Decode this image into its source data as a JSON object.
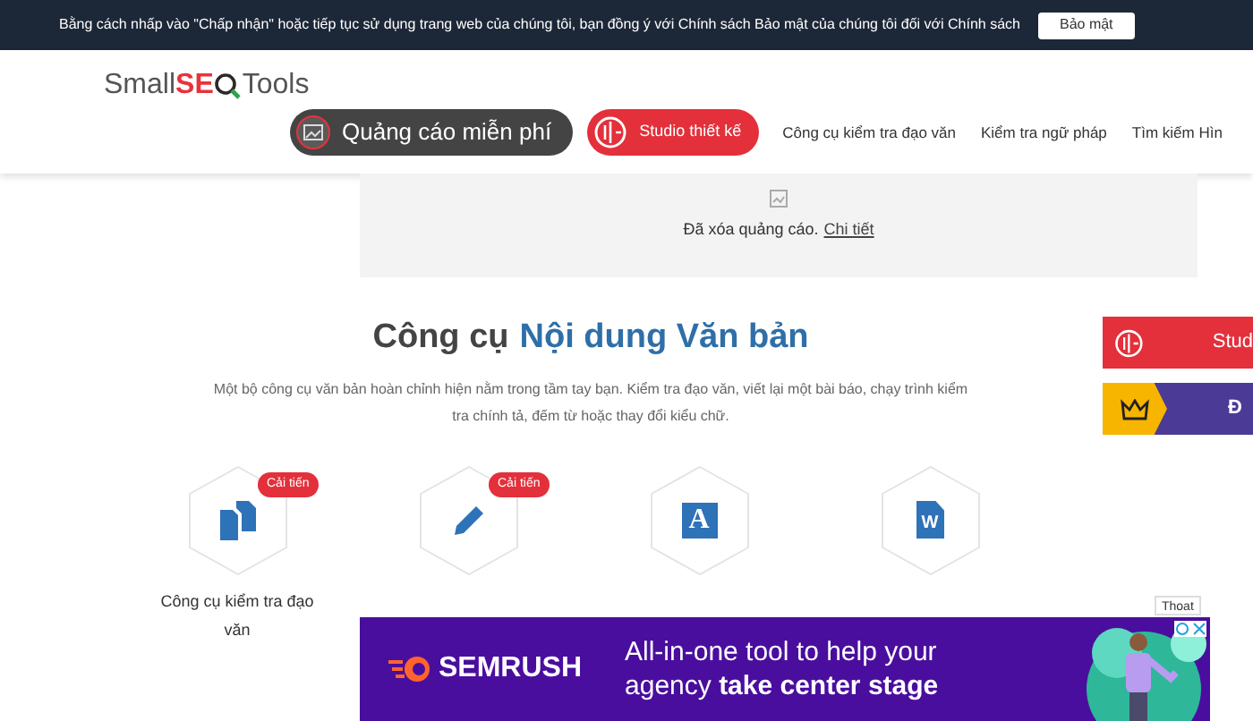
{
  "cookie_bar": {
    "message": "Bằng cách nhấp vào \"Chấp nhận\" hoặc tiếp tục sử dụng trang web của chúng tôi, bạn đồng ý với Chính sách Bảo mật của chúng tôi đối với Chính sách",
    "buttons": [
      "Bảo mật"
    ]
  },
  "header": {
    "logo": {
      "part_1": "Small",
      "part_2": "SE",
      "part_3": "Tools"
    },
    "nav": [
      {
        "label": "Quảng cáo miễn phí",
        "kind": "dark-pill"
      },
      {
        "label": "Studio thiết kế",
        "kind": "red-pill"
      },
      {
        "label": "Công cụ kiểm tra đạo văn",
        "kind": "link"
      },
      {
        "label": "Kiểm tra ngữ pháp",
        "kind": "link"
      },
      {
        "label": "Tìm kiếm Hìn",
        "kind": "link"
      }
    ]
  },
  "ad_notice": {
    "text": "Đã xóa quảng cáo.",
    "link": "Chi tiết"
  },
  "section": {
    "title_1": "Công cụ",
    "title_2": "Nội dung Văn bản",
    "description": "Một bộ công cụ văn bản hoàn chỉnh hiện nằm trong tầm tay bạn. Kiểm tra đạo văn, viết lại một bài báo, chạy trình kiểm tra chính tả, đếm từ hoặc thay đổi kiểu chữ."
  },
  "tools": [
    {
      "label": "Công cụ kiểm tra đạo văn",
      "badge": "Cải tiến",
      "kind": "copy"
    },
    {
      "badge": "Cải tiến",
      "kind": "pencil"
    },
    {
      "kind": "letter",
      "glyph": "A"
    },
    {
      "kind": "document",
      "glyph": "W"
    }
  ],
  "side_buttons": [
    {
      "label": "Stud",
      "kind": "studio"
    },
    {
      "label": "Đ",
      "kind": "premium"
    }
  ],
  "bottom_ad": {
    "close_label": "Thoat",
    "brand": "SEMRUSH",
    "text": "All-in-one tool to help your agency **take center stage**"
  }
}
